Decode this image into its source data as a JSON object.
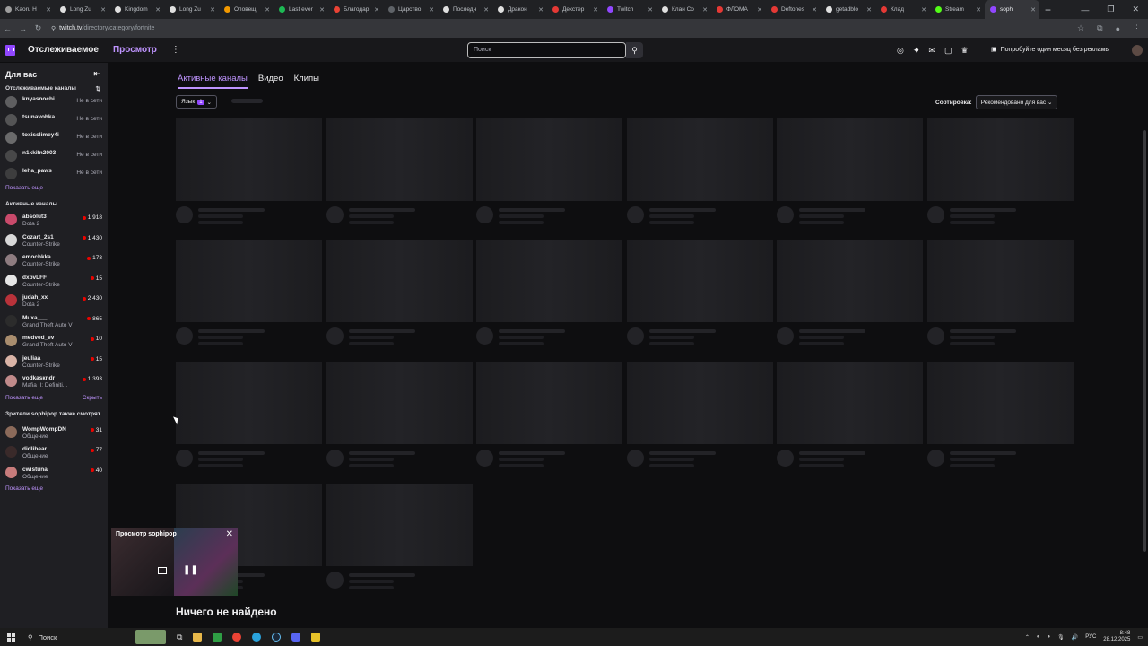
{
  "browser": {
    "tabs": [
      {
        "label": "Kaoru H",
        "color": "#9e9e9e",
        "active": false
      },
      {
        "label": "Long Zu",
        "color": "#e0e0e0",
        "active": false
      },
      {
        "label": "Kingdom",
        "color": "#e0e0e0",
        "active": false
      },
      {
        "label": "Long Zu",
        "color": "#e0e0e0",
        "active": false
      },
      {
        "label": "Оповещ",
        "color": "#f29900",
        "active": false
      },
      {
        "label": "Last ever",
        "color": "#1db954",
        "active": false
      },
      {
        "label": "Благодар",
        "color": "#ea4335",
        "active": false
      },
      {
        "label": "Царство",
        "color": "#5f6368",
        "active": false
      },
      {
        "label": "Последн",
        "color": "#e0e0e0",
        "active": false
      },
      {
        "label": "Дракон",
        "color": "#e0e0e0",
        "active": false
      },
      {
        "label": "Декстер",
        "color": "#e53935",
        "active": false
      },
      {
        "label": "Twitch",
        "color": "#9147ff",
        "active": false
      },
      {
        "label": "Клан Со",
        "color": "#e0e0e0",
        "active": false
      },
      {
        "label": "ФЛОМА",
        "color": "#e53935",
        "active": false
      },
      {
        "label": "Deftones",
        "color": "#e53935",
        "active": false
      },
      {
        "label": "getadblo",
        "color": "#e0e0e0",
        "active": false
      },
      {
        "label": "Клад",
        "color": "#e53935",
        "active": false
      },
      {
        "label": "Stream",
        "color": "#53fc18",
        "active": false
      },
      {
        "label": "soph",
        "color": "#9147ff",
        "active": true
      }
    ],
    "url_host": "twitch.tv",
    "url_path": "/directory/category/fortnite"
  },
  "topnav": {
    "following": "Отслеживаемое",
    "browse": "Просмотр",
    "more": "⋮",
    "search_placeholder": "Поиск",
    "promo": "Попробуйте один месяц без рекламы"
  },
  "sidebar": {
    "for_you": "Для вас",
    "followed_title": "Отслеживаемые каналы",
    "followed": [
      {
        "name": "knyasnochi",
        "status": "Не в сети",
        "color": "#7a7a7a"
      },
      {
        "name": "tsunavohka",
        "status": "Не в сети",
        "color": "#6b6b6b"
      },
      {
        "name": "toxisslimey4i",
        "status": "Не в сети",
        "color": "#8a8a8a"
      },
      {
        "name": "n1kkifn2003",
        "status": "Не в сети",
        "color": "#5a5a5a"
      },
      {
        "name": "leha_paws",
        "status": "Не в сети",
        "color": "#4a4a4a"
      }
    ],
    "show_more": "Показать еще",
    "live_title": "Активные каналы",
    "live": [
      {
        "name": "absolut3",
        "game": "Dota 2",
        "viewers": "1 918",
        "color": "#c94a6b"
      },
      {
        "name": "Cozart_2s1",
        "game": "Counter-Strike",
        "viewers": "1 430",
        "color": "#d8d8d8"
      },
      {
        "name": "emochkka",
        "game": "Counter-Strike",
        "viewers": "173",
        "color": "#8e7c80"
      },
      {
        "name": "dxbvLFF",
        "game": "Counter-Strike",
        "viewers": "15",
        "color": "#e6e6e6"
      },
      {
        "name": "judah_xx",
        "game": "Dota 2",
        "viewers": "2 430",
        "color": "#b8323a"
      },
      {
        "name": "Muxa___",
        "game": "Grand Theft Auto V",
        "viewers": "865",
        "color": "#2c2c2c"
      },
      {
        "name": "medved_ev",
        "game": "Grand Theft Auto V",
        "viewers": "10",
        "color": "#a98d6e"
      },
      {
        "name": "jeuliaa",
        "game": "Counter-Strike",
        "viewers": "15",
        "color": "#d9b3a6"
      },
      {
        "name": "vodkasкndr",
        "game": "Mafia II: Definiti...",
        "viewers": "1 393",
        "color": "#c08a8a"
      }
    ],
    "show_more2": "Показать еще",
    "hide": "Скрыть",
    "also_title": "Зрители sophipop также смотрят",
    "also": [
      {
        "name": "WompWompDN",
        "game": "Общение",
        "viewers": "31",
        "color": "#8b6a5a"
      },
      {
        "name": "didlibear",
        "game": "Общение",
        "viewers": "77",
        "color": "#3a2a2a"
      },
      {
        "name": "cwistuna",
        "game": "Общение",
        "viewers": "40",
        "color": "#c77b7b"
      }
    ],
    "show_more3": "Показать еще"
  },
  "main": {
    "tabs": [
      "Активные каналы",
      "Видео",
      "Клипы"
    ],
    "language_label": "Язык",
    "language_count": "1",
    "sort_label": "Сортировка:",
    "sort_value": "Рекомендовано для вас",
    "nothing_found": "Ничего не найдено"
  },
  "miniplayer": {
    "title": "Просмотр sophipop"
  },
  "taskbar": {
    "search": "Поиск",
    "lang": "РУС",
    "time": "8:48",
    "date": "28.12.2025"
  }
}
